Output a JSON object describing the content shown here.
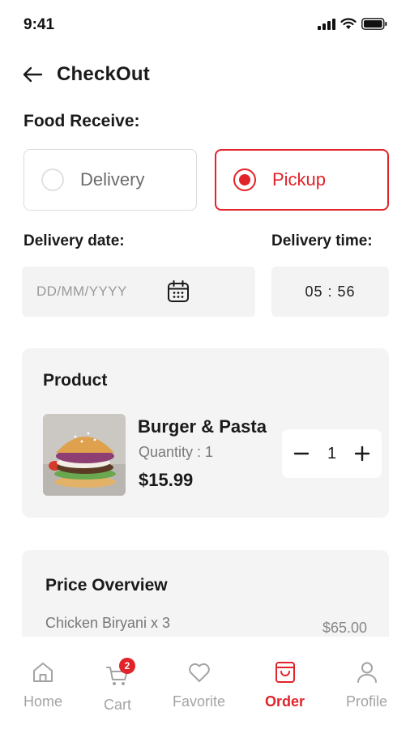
{
  "status_bar": {
    "time": "9:41"
  },
  "header": {
    "title": "CheckOut"
  },
  "food_receive": {
    "label": "Food Receive:",
    "options": [
      {
        "label": "Delivery",
        "selected": false
      },
      {
        "label": "Pickup",
        "selected": true
      }
    ]
  },
  "delivery": {
    "date_label": "Delivery date:",
    "date_placeholder": "DD/MM/YYYY",
    "time_label": "Delivery time:",
    "time_value": "05 : 56"
  },
  "product": {
    "section_title": "Product",
    "name": "Burger & Pasta",
    "quantity_text": "Quantity : 1",
    "price": "$15.99",
    "stepper_value": "1"
  },
  "price_overview": {
    "title": "Price Overview",
    "items": [
      {
        "name": "Chicken Biryani x 3",
        "price": "$65.00"
      }
    ]
  },
  "bottom_nav": {
    "items": [
      {
        "label": "Home",
        "icon": "home-icon",
        "active": false
      },
      {
        "label": "Cart",
        "icon": "cart-icon",
        "active": false,
        "badge": "2"
      },
      {
        "label": "Favorite",
        "icon": "heart-icon",
        "active": false
      },
      {
        "label": "Order",
        "icon": "bag-icon",
        "active": true
      },
      {
        "label": "Profile",
        "icon": "user-icon",
        "active": false
      }
    ]
  },
  "colors": {
    "accent": "#e2232a",
    "card_bg": "#f4f4f4",
    "input_bg": "#f3f3f3"
  }
}
